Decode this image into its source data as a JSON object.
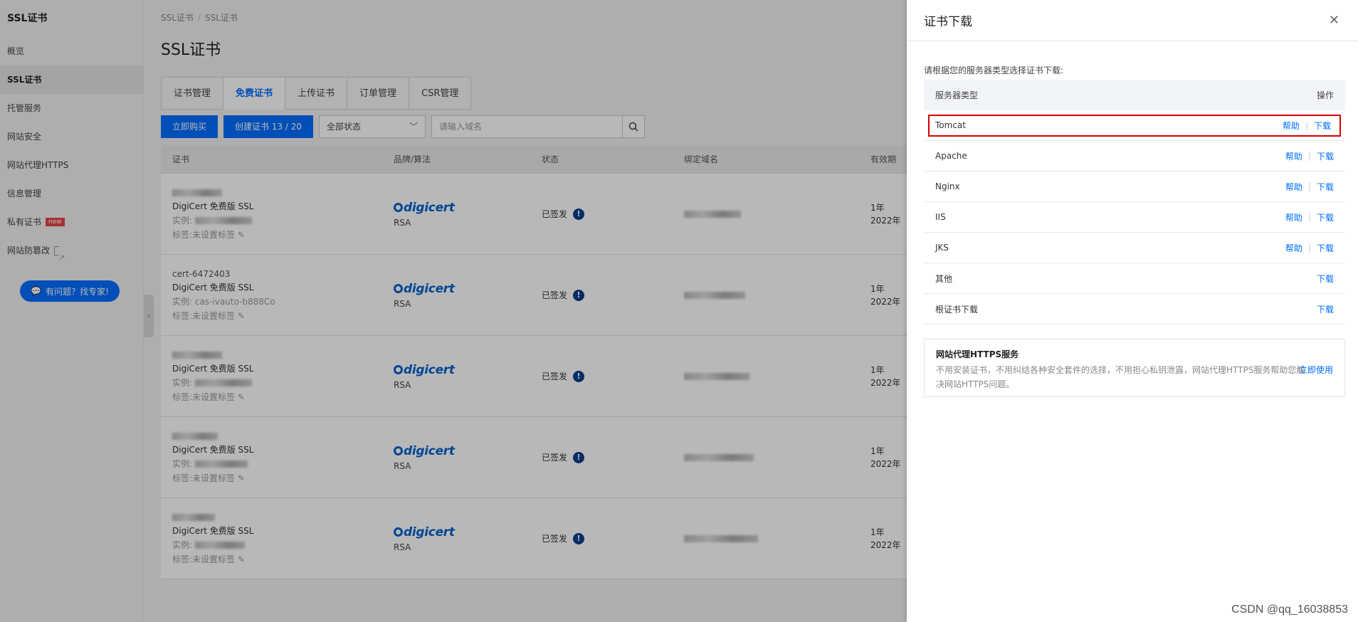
{
  "sidebar": {
    "title": "SSL证书",
    "items": [
      {
        "label": "概览"
      },
      {
        "label": "SSL证书"
      },
      {
        "label": "托管服务"
      },
      {
        "label": "网站安全"
      },
      {
        "label": "网站代理HTTPS"
      },
      {
        "label": "信息管理"
      },
      {
        "label": "私有证书",
        "badge": "new"
      },
      {
        "label": "网站防篡改"
      }
    ],
    "help_button": "有问题？找专家!"
  },
  "main": {
    "breadcrumb": [
      "SSL证书",
      "SSL证书"
    ],
    "title": "SSL证书",
    "tabs": [
      "证书管理",
      "免费证书",
      "上传证书",
      "订单管理",
      "CSR管理"
    ],
    "active_tab": "免费证书",
    "toolbar": {
      "buy": "立即购买",
      "create": "创建证书 13 / 20",
      "status_select": "全部状态",
      "search_placeholder": "请输入域名"
    },
    "table": {
      "headers": [
        "证书",
        "品牌/算法",
        "状态",
        "绑定域名",
        "有效期"
      ],
      "rows": [
        {
          "id": "",
          "name": "DigiCert 免费版 SSL",
          "instance": "实例:",
          "tags": "标签:未设置标签",
          "brand": "digicert",
          "algo": "RSA",
          "status": "已签发",
          "validity": "1年",
          "date": "2022年"
        },
        {
          "id": "cert-6472403",
          "name": "DigiCert 免费版 SSL",
          "instance": "实例: cas-ivauto-b888Co",
          "tags": "标签:未设置标签",
          "brand": "digicert",
          "algo": "RSA",
          "status": "已签发",
          "validity": "1年",
          "date": "2022年"
        },
        {
          "id": "",
          "name": "DigiCert 免费版 SSL",
          "instance": "实例:",
          "tags": "标签:未设置标签",
          "brand": "digicert",
          "algo": "RSA",
          "status": "已签发",
          "validity": "1年",
          "date": "2022年"
        },
        {
          "id": "",
          "name": "DigiCert 免费版 SSL",
          "instance": "实例:",
          "tags": "标签:未设置标签",
          "brand": "digicert",
          "algo": "RSA",
          "status": "已签发",
          "validity": "1年",
          "date": "2022年"
        },
        {
          "id": "",
          "name": "DigiCert 免费版 SSL",
          "instance": "实例:",
          "tags": "标签:未设置标签",
          "brand": "digicert",
          "algo": "RSA",
          "status": "已签发",
          "validity": "1年",
          "date": "2022年"
        }
      ]
    }
  },
  "drawer": {
    "title": "证书下载",
    "hint": "请根据您的服务器类型选择证书下载:",
    "col_server": "服务器类型",
    "col_ops": "操作",
    "help_label": "帮助",
    "download_label": "下载",
    "servers": [
      {
        "name": "Tomcat",
        "help": true
      },
      {
        "name": "Apache",
        "help": true
      },
      {
        "name": "Nginx",
        "help": true
      },
      {
        "name": "IIS",
        "help": true
      },
      {
        "name": "JKS",
        "help": true
      },
      {
        "name": "其他",
        "help": false
      },
      {
        "name": "根证书下载",
        "help": false
      }
    ],
    "highlighted": "Tomcat",
    "promo": {
      "title": "网站代理HTTPS服务",
      "desc": "不用安装证书，不用纠结各种安全套件的选择，不用担心私钥泄露，网站代理HTTPS服务帮助您解决网站HTTPS问题。",
      "link": "立即使用"
    }
  },
  "watermark": "CSDN @qq_16038853",
  "colors": {
    "accent": "#006eff",
    "highlight_border": "#d40000"
  }
}
